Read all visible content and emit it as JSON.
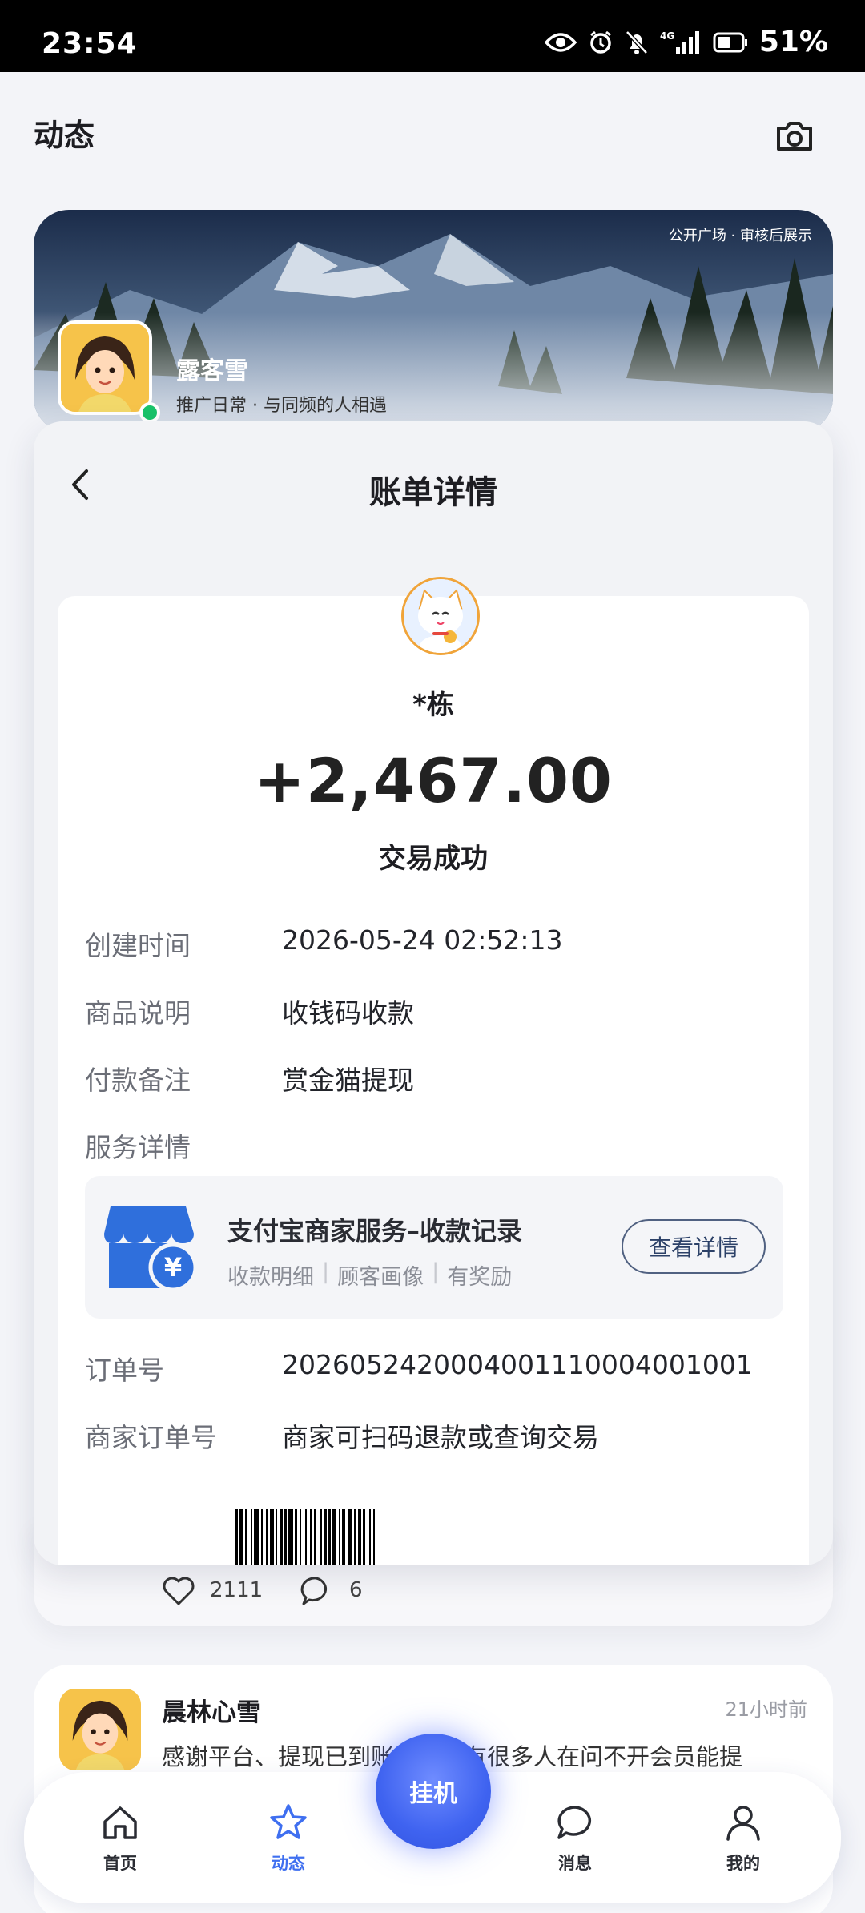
{
  "status_bar": {
    "time": "23:54",
    "network": "4G",
    "battery": "51%"
  },
  "header": {
    "title": "动态"
  },
  "banner": {
    "tag": "公开广场 · 审核后展示",
    "name": "露客雪",
    "subtitle": "推广日常 · 与同频的人相遇"
  },
  "bill": {
    "title": "账单详情",
    "payer": "*栋",
    "amount": "+2,467.00",
    "status": "交易成功",
    "rows": [
      {
        "label": "创建时间",
        "value": "2026-05-24 02:52:13"
      },
      {
        "label": "商品说明",
        "value": "收钱码收款"
      },
      {
        "label": "付款备注",
        "value": "赏金猫提现"
      },
      {
        "label": "服务详情",
        "value": ""
      },
      {
        "label": "订单号",
        "value": "2026052420004001110004001001"
      },
      {
        "label": "商家订单号",
        "value": "商家可扫码退款或查询交易"
      }
    ],
    "service": {
      "title": "支付宝商家服务–收款记录",
      "tags": [
        "收款明细",
        "顾客画像",
        "有奖励"
      ],
      "button": "查看详情",
      "currency_symbol": "¥"
    }
  },
  "post_stats": {
    "likes": "2111",
    "comments": "6"
  },
  "post": {
    "name": "晨林心雪",
    "time": "21小时前",
    "text": "感谢平台、提现已到账，看到有很多人在问不开会员能提"
  },
  "nav": {
    "items": [
      {
        "label": "首页",
        "icon": "home-icon"
      },
      {
        "label": "动态",
        "icon": "star-icon"
      },
      {
        "label": "消息",
        "icon": "message-icon"
      },
      {
        "label": "我的",
        "icon": "user-icon"
      }
    ],
    "fab_label": "挂机",
    "active_color": "#3f6ff0"
  }
}
